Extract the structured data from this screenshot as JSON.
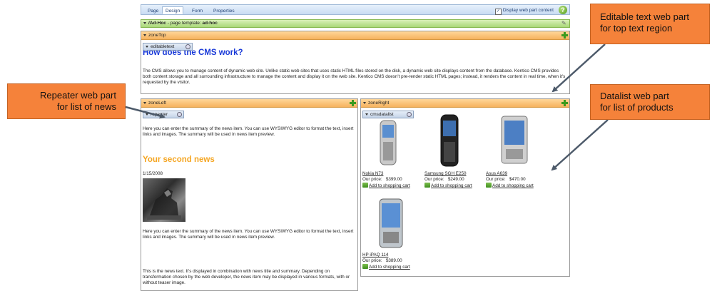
{
  "tabs": [
    {
      "label": "Page"
    },
    {
      "label": "Design"
    },
    {
      "label": "Form"
    },
    {
      "label": "Properties"
    }
  ],
  "display_web_part_content": {
    "label": "Display web part content",
    "checked": true
  },
  "page_template": {
    "prefix": "/Ad-Hoc",
    "middle": " - page template: ",
    "name": "ad-hoc"
  },
  "zone_top": {
    "label": "zoneTop",
    "web_part": "editabletext",
    "heading": "How does the CMS work?",
    "text": "The CMS allows you to manage content of dynamic web site. Unlike static web sites that uses static HTML files stored on the disk, a dynamic web site displays content from the database. Kentico CMS provides both content storage and all surrounding infrastructure to manage the content and display it on the web site. Kentico CMS doesn't pre-render static HTML pages; instead, it renders the content in real time, when it's requested by the visitor."
  },
  "zone_left": {
    "label": "zoneLeft",
    "web_part": "repeater",
    "summary_1": "Here you can enter the summary of the news item. You can use WYSIWYG editor to format the text, insert links and images. The summary will be used in news item preview.",
    "news_title": "Your second news",
    "news_date": "1/15/2008",
    "summary_2": "Here you can enter the summary of the news item. You can use WYSIWYG editor to format the text, insert links and images. The summary will be used in news item preview.",
    "news_text": "This is the news text. It's displayed in combination with news title and summary. Depending on transformation chosen by the web developer, the news item may be displayed in various formats, with or without teaser image."
  },
  "zone_right": {
    "label": "zoneRight",
    "web_part": "cmsdatalist",
    "products": [
      {
        "name": "Nokia N73",
        "price_label": "Our price:",
        "price": "$399.00",
        "cart": "Add to shopping cart"
      },
      {
        "name": "Samsung SGH E250",
        "price_label": "Our price:",
        "price": "$249.00",
        "cart": "Add to shopping cart"
      },
      {
        "name": "Asus A639",
        "price_label": "Our price:",
        "price": "$470.00",
        "cart": "Add to shopping cart"
      },
      {
        "name": "HP iPAQ 114",
        "price_label": "Our price:",
        "price": "$389.00",
        "cart": "Add to shopping cart"
      }
    ]
  },
  "callouts": {
    "editable": {
      "line1": "Editable text web part",
      "line2": "for top text region"
    },
    "repeater": {
      "line1": "Repeater web part",
      "line2": "for list of news"
    },
    "datalist": {
      "line1": "Datalist web part",
      "line2": "for list of products"
    }
  },
  "colors": {
    "callout": "#f5823a",
    "zone_header": "#f6b25e",
    "template_bar": "#a9d878",
    "heading_blue": "#1a3ad8",
    "heading_orange": "#f5a623"
  }
}
